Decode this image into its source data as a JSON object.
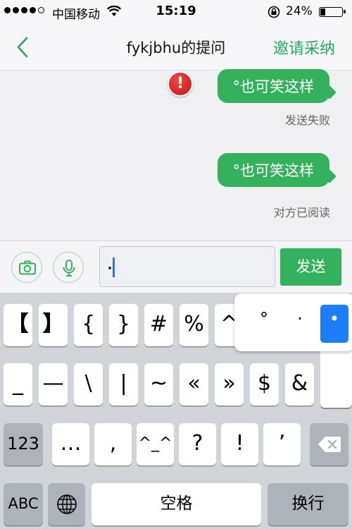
{
  "status_bar": {
    "carrier": "中国移动",
    "time": "15:19",
    "battery_percent": "24%",
    "battery_level": 0.24,
    "signal_bars": 4
  },
  "nav": {
    "back_icon": "chevron-left-icon",
    "title": "fykjbhu的提问",
    "action": "邀请采纳"
  },
  "chat": {
    "messages": [
      {
        "text": "°也可笑这样",
        "status": "发送失败",
        "failed": true,
        "fail_icon": "!"
      },
      {
        "text": "°也可笑这样",
        "status": "对方已阅读",
        "failed": false
      }
    ]
  },
  "input_bar": {
    "camera_icon": "camera-icon",
    "mic_icon": "microphone-icon",
    "value": "•",
    "send_label": "发送"
  },
  "keyboard": {
    "row1": [
      "【",
      "】",
      "{",
      "}",
      "#",
      "%",
      "^"
    ],
    "row2": [
      "_",
      "—",
      "\\",
      "|",
      "~",
      "«",
      "»",
      "$",
      "&"
    ],
    "row3": [
      "123",
      "…",
      ",",
      "^_^",
      "?",
      "!",
      "’"
    ],
    "row4": {
      "abc": "ABC",
      "globe_icon": "globe-icon",
      "space": "空格",
      "return": "换行"
    },
    "backspace_icon": "backspace-icon",
    "popup_options": [
      "°",
      "·",
      "•"
    ],
    "popup_selected": "•"
  },
  "colors": {
    "accent": "#35b15d",
    "nav_action": "#2aa757",
    "fail_red": "#d32020",
    "key_selected": "#1e7ef7"
  }
}
